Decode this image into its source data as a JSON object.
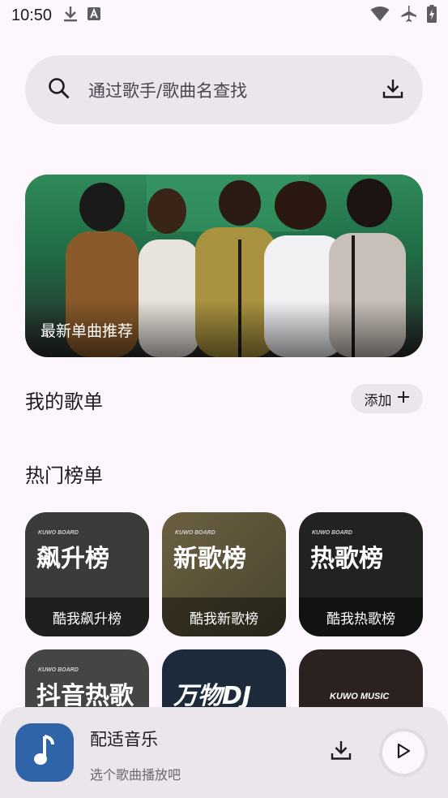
{
  "status_bar": {
    "time": "10:50"
  },
  "search": {
    "placeholder": "通过歌手/歌曲名查找"
  },
  "banner": {
    "title": "最新单曲推荐"
  },
  "my_playlists": {
    "title": "我的歌单",
    "add_label": "添加"
  },
  "hot_charts": {
    "title": "热门榜单",
    "cards": [
      {
        "board": "KUWO BOARD",
        "big_text": "飙升榜",
        "label": "酷我飙升榜",
        "color": "#3a3a3a"
      },
      {
        "board": "KUWO BOARD",
        "big_text": "新歌榜",
        "label": "酷我新歌榜",
        "color": "#5a5236"
      },
      {
        "board": "KUWO BOARD",
        "big_text": "热歌榜",
        "label": "酷我热歌榜",
        "color": "#222222"
      },
      {
        "board": "KUWO BOARD",
        "big_text": "抖音热歌",
        "label": "",
        "color": "#454545"
      },
      {
        "board": "",
        "big_text": "万物DJ",
        "label": "",
        "color": "#1d2a3a"
      },
      {
        "board": "KUWO MUSIC",
        "big_text": "",
        "label": "",
        "color": "#2b2220"
      }
    ]
  },
  "player": {
    "title": "配适音乐",
    "subtitle": "选个歌曲播放吧"
  },
  "colors": {
    "background": "#fdf7fd",
    "surface": "#ebe5ec",
    "album_art": "#2f64a8"
  }
}
